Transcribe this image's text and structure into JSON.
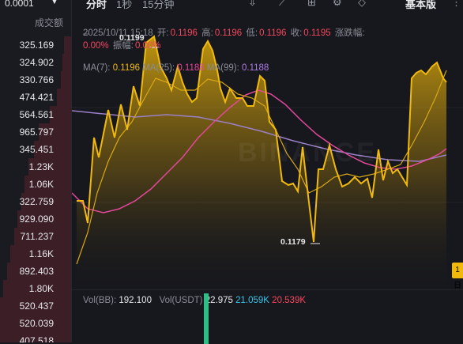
{
  "orderbook": {
    "step": "0.0001",
    "column_header": "成交额",
    "rows": [
      {
        "qty": "325.169",
        "depth": 0.1
      },
      {
        "qty": "324.902",
        "depth": 0.12
      },
      {
        "qty": "330.766",
        "depth": 0.14
      },
      {
        "qty": "474.421",
        "depth": 0.2
      },
      {
        "qty": "564.561",
        "depth": 0.3
      },
      {
        "qty": "965.797",
        "depth": 0.45
      },
      {
        "qty": "345.451",
        "depth": 0.52
      },
      {
        "qty": "1.23K",
        "depth": 0.6
      },
      {
        "qty": "1.06K",
        "depth": 0.66
      },
      {
        "qty": "322.759",
        "depth": 0.7
      },
      {
        "qty": "929.090",
        "depth": 0.76
      },
      {
        "qty": "711.237",
        "depth": 0.8
      },
      {
        "qty": "1.16K",
        "depth": 0.86
      },
      {
        "qty": "892.403",
        "depth": 0.9
      },
      {
        "qty": "1.80K",
        "depth": 0.96
      },
      {
        "qty": "520.437",
        "depth": 1.0
      },
      {
        "qty": "520.039",
        "depth": 1.0
      },
      {
        "qty": "407.518",
        "depth": 1.0
      }
    ]
  },
  "topbar": {
    "tabs": [
      "分时",
      "1秒",
      "15分钟"
    ],
    "right_tab": "基本版"
  },
  "chart": {
    "ohlc": {
      "datetime": "2025/10/11 15:18",
      "open_label": "开:",
      "open": "0.1196",
      "high_label": "高:",
      "high": "0.1196",
      "low_label": "低:",
      "low": "0.1196",
      "close_label": "收:",
      "close": "0.1195",
      "change_label": "涨跌幅:",
      "change": "0.00%",
      "amplitude_label": "振幅:",
      "amplitude": "0.00%"
    },
    "ma": {
      "ma7_label": "MA(7):",
      "ma7": "0.1196",
      "ma25_label": "MA(25):",
      "ma25": "0.1188",
      "ma99_label": "MA(99):",
      "ma99": "0.1188"
    },
    "high_marker": "0.1199",
    "low_marker": "0.1179",
    "watermark": "BINANCE",
    "timeframe_badge": "1日",
    "colors": {
      "price": "#f0b90b",
      "ma25": "#e3479a",
      "ma99": "#9a80c8"
    }
  },
  "volume": {
    "vol_bb_label": "Vol(BB):",
    "vol_bb": "192.100",
    "vol_usdt_label": "Vol(USDT)",
    "vol_usdt": "22.975",
    "buy": "21.059K",
    "sell": "20.539K"
  }
}
